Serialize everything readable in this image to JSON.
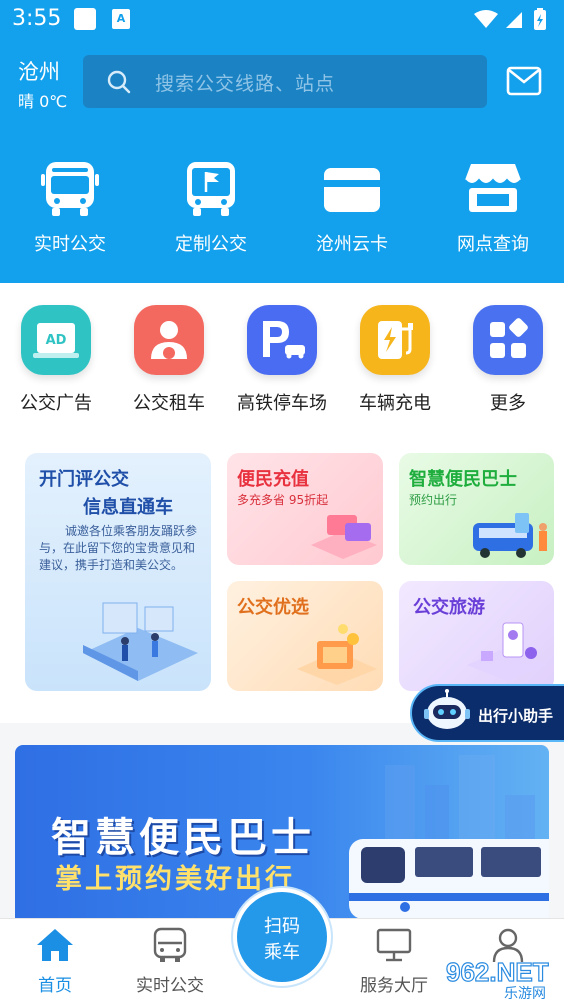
{
  "status": {
    "time": "3:55",
    "a_icon": "A"
  },
  "header": {
    "city": "沧州",
    "weather": "晴 0℃",
    "search_placeholder": "搜索公交线路、站点"
  },
  "top_nav": [
    {
      "label": "实时公交",
      "icon": "bus-icon"
    },
    {
      "label": "定制公交",
      "icon": "custom-bus-icon"
    },
    {
      "label": "沧州云卡",
      "icon": "card-icon"
    },
    {
      "label": "网点查询",
      "icon": "store-icon"
    }
  ],
  "services": [
    {
      "label": "公交广告",
      "icon": "ad-icon",
      "icon_text": "AD",
      "color": "#2fc3c4"
    },
    {
      "label": "公交租车",
      "icon": "driver-icon",
      "color": "#f4695f"
    },
    {
      "label": "高铁停车场",
      "icon": "parking-icon",
      "color": "#4a6cf2"
    },
    {
      "label": "车辆充电",
      "icon": "charging-icon",
      "color": "#f6b51b"
    },
    {
      "label": "更多",
      "icon": "more-icon",
      "color": "#4a72f0"
    }
  ],
  "cards": {
    "feedback": {
      "title1": "开门评公交",
      "title2": "信息直通车",
      "desc": "诚邀各位乘客朋友踊跃参与，在此留下您的宝贵意见和建议，携手打造和美公交。"
    },
    "recharge": {
      "title": "便民充值",
      "sub": "多充多省 95折起"
    },
    "smart_bus": {
      "title": "智慧便民巴士",
      "sub": "预约出行"
    },
    "select": {
      "title": "公交优选"
    },
    "travel": {
      "title": "公交旅游"
    }
  },
  "assistant": {
    "label": "出行小助手"
  },
  "banner": {
    "line1": "智慧便民巴士",
    "line2": "掌上预约美好出行"
  },
  "bottom_nav": {
    "home": "首页",
    "realtime": "实时公交",
    "scan_line1": "扫码",
    "scan_line2": "乘车",
    "service_hall": "服务大厅"
  },
  "watermark": {
    "text": "962.NET",
    "sub": "乐游网"
  }
}
